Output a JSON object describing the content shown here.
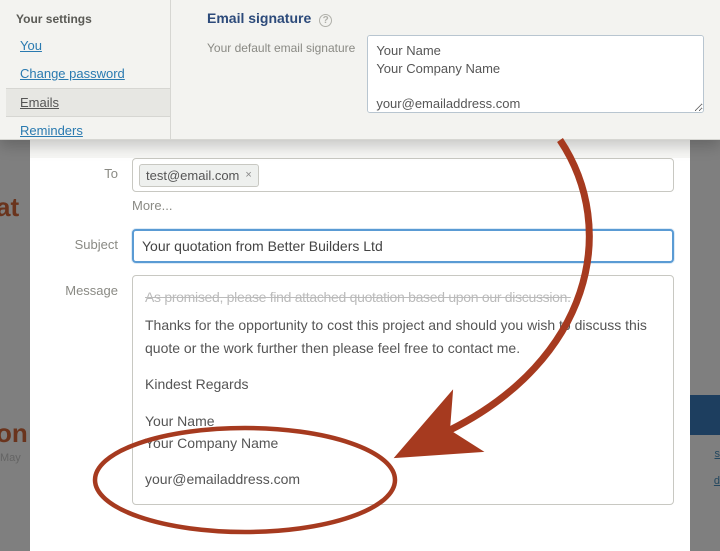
{
  "settings": {
    "heading": "Your settings",
    "nav": {
      "you": "You",
      "change_password": "Change password",
      "emails": "Emails",
      "reminders": "Reminders"
    },
    "section_title": "Email signature",
    "sig_label": "Your default email signature",
    "sig_value": "Your Name\nYour Company Name\n\nyour@emailaddress.com"
  },
  "compose": {
    "to_label": "To",
    "to_chip": "test@email.com",
    "more_label": "More...",
    "subject_label": "Subject",
    "subject_value": "Your quotation from Better Builders Ltd",
    "message_label": "Message",
    "msg_cutoff": "As promised, please find attached quotation based upon our discussion.",
    "msg_line1": "Thanks for the opportunity to cost this project and should you wish to discuss this quote or the work further then please feel free to contact me.",
    "msg_line2": "Kindest Regards",
    "msg_sig1": "Your Name",
    "msg_sig2": "Your Company Name",
    "msg_sig3": "your@emailaddress.com"
  },
  "bg": {
    "at": "at",
    "on": "on",
    "may": "May"
  }
}
